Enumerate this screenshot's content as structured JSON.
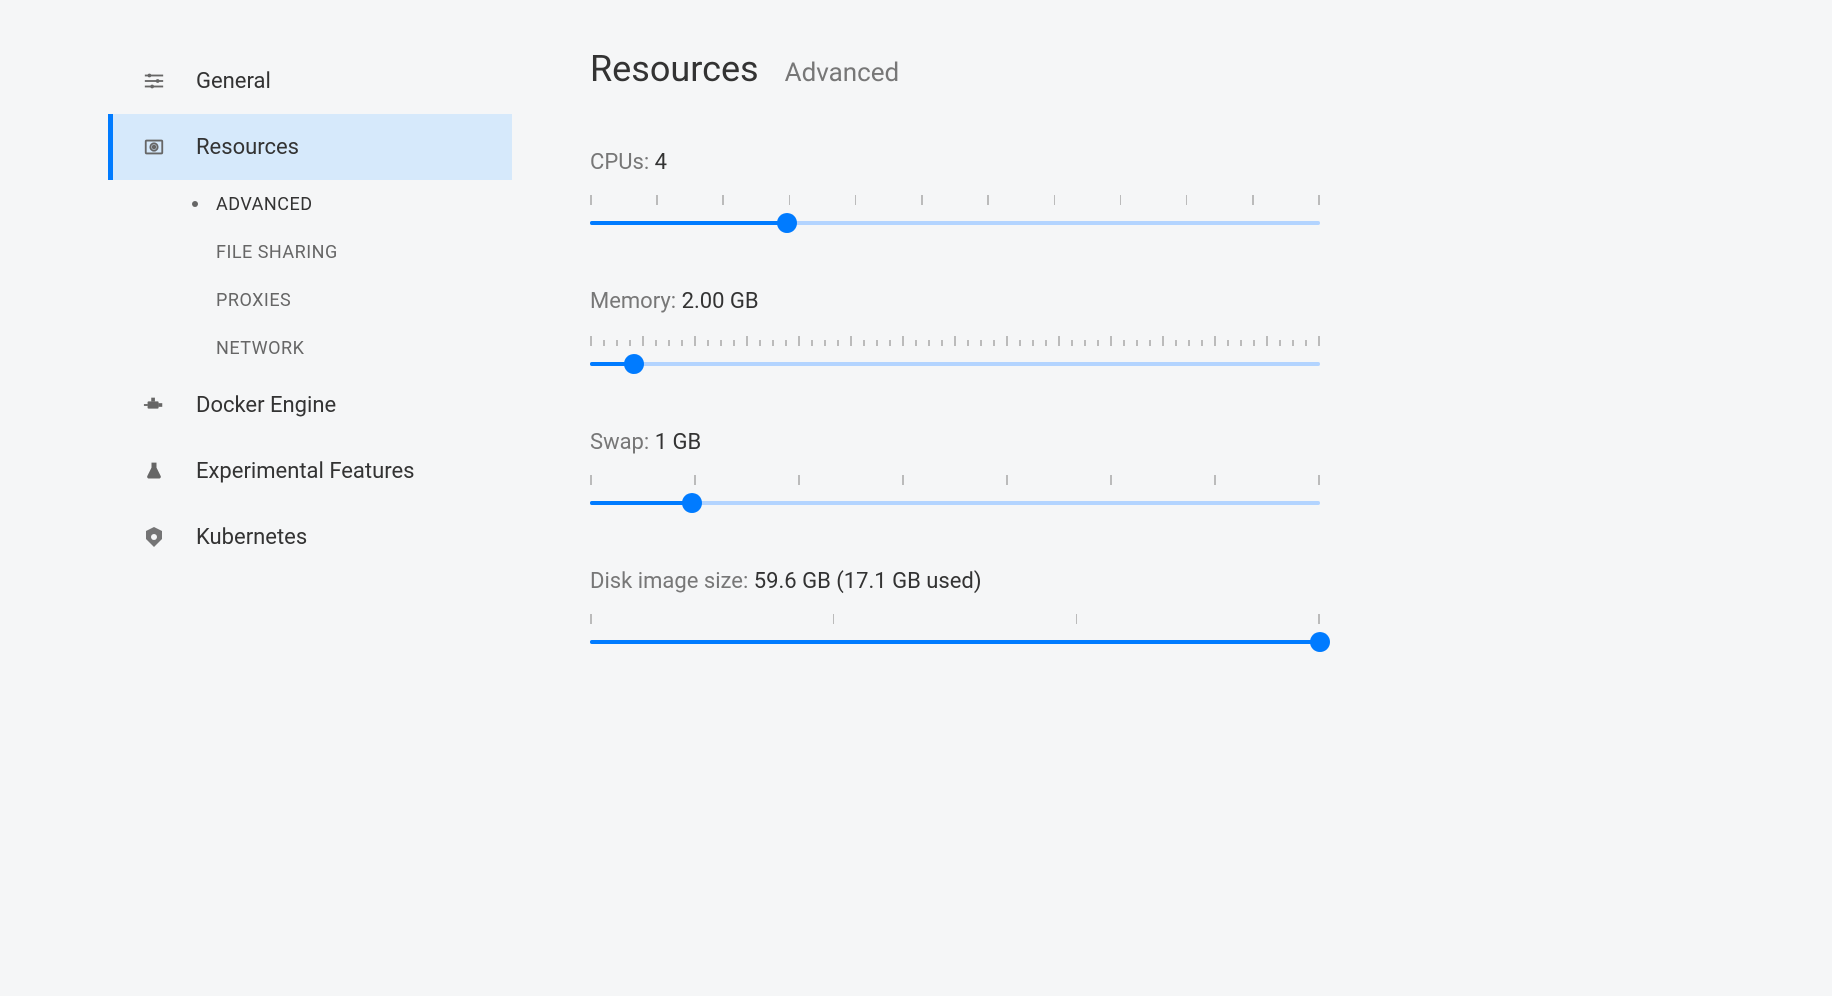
{
  "sidebar": {
    "items": [
      {
        "label": "General"
      },
      {
        "label": "Resources"
      },
      {
        "label": "Docker Engine"
      },
      {
        "label": "Experimental Features"
      },
      {
        "label": "Kubernetes"
      }
    ],
    "sub_items": [
      {
        "label": "ADVANCED"
      },
      {
        "label": "FILE SHARING"
      },
      {
        "label": "PROXIES"
      },
      {
        "label": "NETWORK"
      }
    ]
  },
  "header": {
    "title": "Resources",
    "subtitle": "Advanced"
  },
  "settings": {
    "cpus": {
      "label": "CPUs:",
      "value": "4",
      "fill_pct": 27,
      "tick_count": 12
    },
    "memory": {
      "label": "Memory:",
      "value": "2.00 GB",
      "fill_pct": 6,
      "major_count": 15,
      "minor_between": 3
    },
    "swap": {
      "label": "Swap:",
      "value": "1 GB",
      "fill_pct": 14,
      "tick_count": 8
    },
    "disk": {
      "label": "Disk image size:",
      "value": "59.6 GB (17.1 GB used)",
      "fill_pct": 100,
      "tick_count": 4
    }
  }
}
